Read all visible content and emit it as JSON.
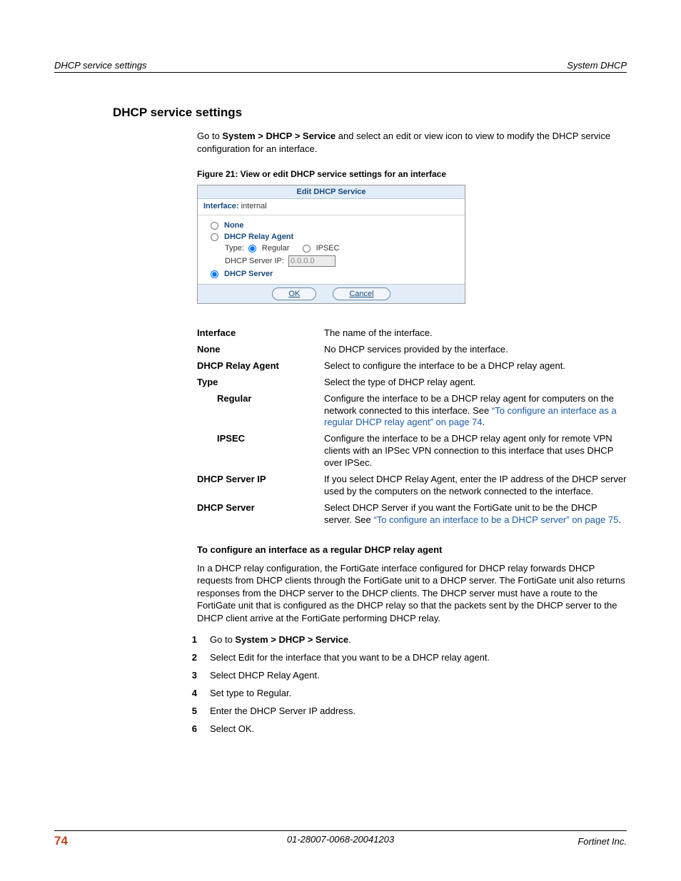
{
  "header": {
    "left": "DHCP service settings",
    "right": "System DHCP"
  },
  "section_title": "DHCP service settings",
  "intro": {
    "pre": "Go to ",
    "bold": "System > DHCP > Service",
    "post": " and select an edit or view icon to view to modify the DHCP service configuration for an interface."
  },
  "figure_caption": "Figure 21: View or edit DHCP service settings for an interface",
  "screenshot": {
    "title": "Edit DHCP Service",
    "interface_label": "Interface:",
    "interface_value": "internal",
    "opt_none": "None",
    "opt_relay": "DHCP Relay Agent",
    "type_label": "Type:",
    "type_regular": "Regular",
    "type_ipsec": "IPSEC",
    "server_ip_label": "DHCP Server IP:",
    "server_ip_value": "0.0.0.0",
    "opt_server": "DHCP Server",
    "btn_ok": "OK",
    "btn_cancel": "Cancel"
  },
  "defs": {
    "interface": {
      "term": "Interface",
      "desc": "The name of the interface."
    },
    "none": {
      "term": "None",
      "desc": "No DHCP services provided by the interface."
    },
    "relay": {
      "term": "DHCP Relay Agent",
      "desc": "Select to configure the interface to be a DHCP relay agent."
    },
    "type": {
      "term": "Type",
      "desc": "Select the type of DHCP relay agent."
    },
    "regular": {
      "term": "Regular",
      "desc_pre": "Configure the interface to be a DHCP relay agent for computers on the network connected to this interface. See ",
      "link": "“To configure an interface as a regular DHCP relay agent” on page 74",
      "desc_post": "."
    },
    "ipsec": {
      "term": "IPSEC",
      "desc": "Configure the interface to be a DHCP relay agent only for remote VPN clients with an IPSec VPN connection to this interface that uses DHCP over IPSec."
    },
    "server_ip": {
      "term": "DHCP Server IP",
      "desc": "If you select DHCP Relay Agent, enter the IP address of the DHCP server used by the computers on the network connected to the interface."
    },
    "server": {
      "term": "DHCP Server",
      "desc_pre": "Select DHCP Server if you want the FortiGate unit to be the DHCP server. See ",
      "link": "“To configure an interface to be a DHCP server” on page 75",
      "desc_post": "."
    }
  },
  "subhead": "To configure an interface as a regular DHCP relay agent",
  "relay_para": "In a DHCP relay configuration, the FortiGate interface configured for DHCP relay forwards DHCP requests from DHCP clients through the FortiGate unit to a DHCP server. The FortiGate unit also returns responses from the DHCP server to the DHCP clients. The DHCP server must have a route to the FortiGate unit that is configured as the DHCP relay so that the packets sent by the DHCP server to the DHCP client arrive at the FortiGate performing DHCP relay.",
  "steps": {
    "s1": {
      "n": "1",
      "pre": "Go to ",
      "bold": "System > DHCP > Service",
      "post": "."
    },
    "s2": {
      "n": "2",
      "text": "Select Edit for the interface that you want to be a DHCP relay agent."
    },
    "s3": {
      "n": "3",
      "text": "Select DHCP Relay Agent."
    },
    "s4": {
      "n": "4",
      "text": "Set type to Regular."
    },
    "s5": {
      "n": "5",
      "text": "Enter the DHCP Server IP address."
    },
    "s6": {
      "n": "6",
      "text": "Select OK."
    }
  },
  "footer": {
    "page": "74",
    "mid": "01-28007-0068-20041203",
    "right": "Fortinet Inc."
  }
}
